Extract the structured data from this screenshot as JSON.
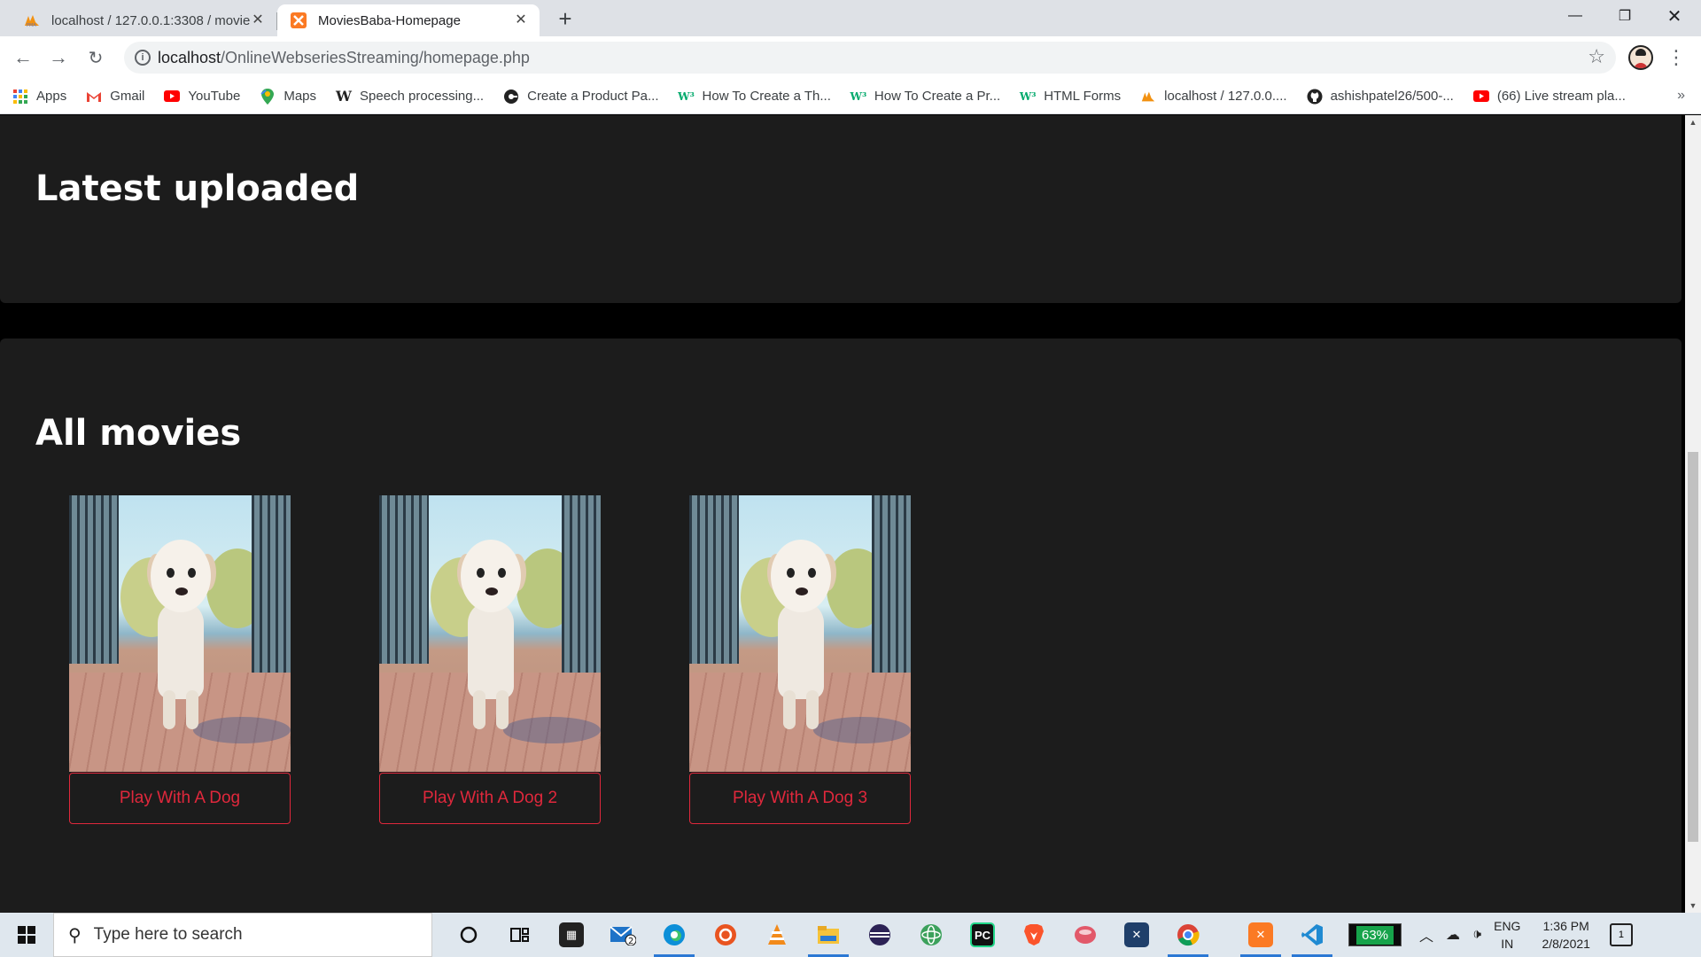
{
  "browser": {
    "tabs": [
      {
        "title": "localhost / 127.0.0.1:3308 / movie",
        "favicon": "phpmyadmin-icon",
        "active": false
      },
      {
        "title": "MoviesBaba-Homepage",
        "favicon": "xampp-icon",
        "active": true
      }
    ],
    "address": {
      "host": "localhost",
      "path": "/OnlineWebseriesStreaming/homepage.php"
    },
    "bookmarks": [
      {
        "label": "Apps",
        "icon": "apps-grid-icon"
      },
      {
        "label": "Gmail",
        "icon": "gmail-icon"
      },
      {
        "label": "YouTube",
        "icon": "youtube-icon"
      },
      {
        "label": "Maps",
        "icon": "maps-icon"
      },
      {
        "label": "Speech processing...",
        "icon": "wikipedia-icon"
      },
      {
        "label": "Create a Product Pa...",
        "icon": "site-icon"
      },
      {
        "label": "How To Create a Th...",
        "icon": "w3schools-icon"
      },
      {
        "label": "How To Create a Pr...",
        "icon": "w3schools-icon"
      },
      {
        "label": "HTML Forms",
        "icon": "w3schools-icon"
      },
      {
        "label": "localhost / 127.0.0....",
        "icon": "phpmyadmin-icon"
      },
      {
        "label": "ashishpatel26/500-...",
        "icon": "github-icon"
      },
      {
        "label": "(66) Live stream pla...",
        "icon": "youtube-icon"
      }
    ]
  },
  "page": {
    "latest_heading": "Latest uploaded",
    "all_heading": "All movies",
    "movies": [
      {
        "title": "Play With A Dog"
      },
      {
        "title": "Play With A Dog 2"
      },
      {
        "title": "Play With A Dog 3"
      }
    ]
  },
  "taskbar": {
    "search_placeholder": "Type here to search",
    "battery": "63%",
    "lang_line1": "ENG",
    "lang_line2": "IN",
    "time": "1:36 PM",
    "date": "2/8/2021",
    "notification_count": "1",
    "mail_badge": "2"
  },
  "colors": {
    "accent_red": "#e0283c",
    "panel_bg": "#1c1c1c",
    "page_bg": "#000000"
  }
}
